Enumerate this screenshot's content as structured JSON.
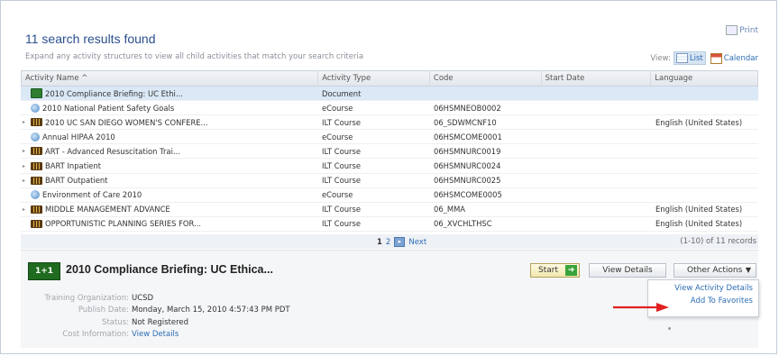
{
  "print_label": "Print",
  "results_title": "11 search results found",
  "subtitle": "Expand any activity structures to view all child activities that match your search criteria",
  "view": {
    "label": "View:",
    "list_label": "List",
    "calendar_label": "Calendar",
    "active": "List"
  },
  "table": {
    "columns": [
      "Activity Name ^",
      "Activity Type",
      "Code",
      "Start Date",
      "Language"
    ],
    "rows": [
      {
        "name": "2010 Compliance Briefing: UC Ethi...",
        "type": "Document",
        "code": "",
        "start": "",
        "lang": "",
        "icon": "document-icon",
        "expandable": false,
        "selected": true
      },
      {
        "name": "2010 National Patient Safety Goals",
        "type": "eCourse",
        "code": "06HSMNEOB0002",
        "start": "",
        "lang": "",
        "icon": "ecourse-icon",
        "expandable": false
      },
      {
        "name": "2010 UC SAN DIEGO WOMEN'S CONFERE...",
        "type": "ILT Course",
        "code": "06_SDWMCNF10",
        "start": "",
        "lang": "English (United States)",
        "icon": "ilt-course-icon",
        "expandable": true
      },
      {
        "name": "Annual HIPAA 2010",
        "type": "eCourse",
        "code": "06HSMCOME0001",
        "start": "",
        "lang": "",
        "icon": "ecourse-icon",
        "expandable": false
      },
      {
        "name": "ART - Advanced Resuscitation Trai...",
        "type": "ILT Course",
        "code": "06HSMNURC0019",
        "start": "",
        "lang": "",
        "icon": "ilt-course-icon",
        "expandable": true
      },
      {
        "name": "BART Inpatient",
        "type": "ILT Course",
        "code": "06HSMNURC0024",
        "start": "",
        "lang": "",
        "icon": "ilt-course-icon",
        "expandable": true
      },
      {
        "name": "BART Outpatient",
        "type": "ILT Course",
        "code": "06HSMNURC0025",
        "start": "",
        "lang": "",
        "icon": "ilt-course-icon",
        "expandable": true
      },
      {
        "name": "Environment of Care 2010",
        "type": "eCourse",
        "code": "06HSMCOME0005",
        "start": "",
        "lang": "",
        "icon": "ecourse-icon",
        "expandable": false
      },
      {
        "name": "MIDDLE MANAGEMENT ADVANCE",
        "type": "ILT Course",
        "code": "06_MMA",
        "start": "",
        "lang": "English (United States)",
        "icon": "ilt-course-icon",
        "expandable": true
      },
      {
        "name": "OPPORTUNISTIC PLANNING SERIES FOR...",
        "type": "ILT Course",
        "code": "06_XVCHLTHSC",
        "start": "",
        "lang": "English (United States)",
        "icon": "ilt-course-icon",
        "expandable": false
      }
    ]
  },
  "pager": {
    "page1": "1",
    "page2": "2",
    "next": "Next",
    "count": "(1-10) of 11 records"
  },
  "detail": {
    "icon_text": "1+1",
    "title": "2010 Compliance Briefing: UC Ethica...",
    "start_label": "Start",
    "view_details_label": "View Details",
    "other_actions_label": "Other Actions",
    "menu": [
      "View Activity Details",
      "Add To Favorites"
    ],
    "fields": [
      {
        "label": "Training Organization:",
        "value": "UCSD",
        "link": false
      },
      {
        "label": "Publish Date:",
        "value": "Monday, March 15, 2010 4:57:43 PM PDT",
        "link": false
      },
      {
        "label": "Status:",
        "value": "Not Registered",
        "link": false
      },
      {
        "label": "Cost Information:",
        "value": "View Details",
        "link": true
      }
    ]
  },
  "colors": {
    "link": "#2e6db4",
    "selected_row": "#dbe8f6",
    "annotation_arrow": "#e02020"
  }
}
